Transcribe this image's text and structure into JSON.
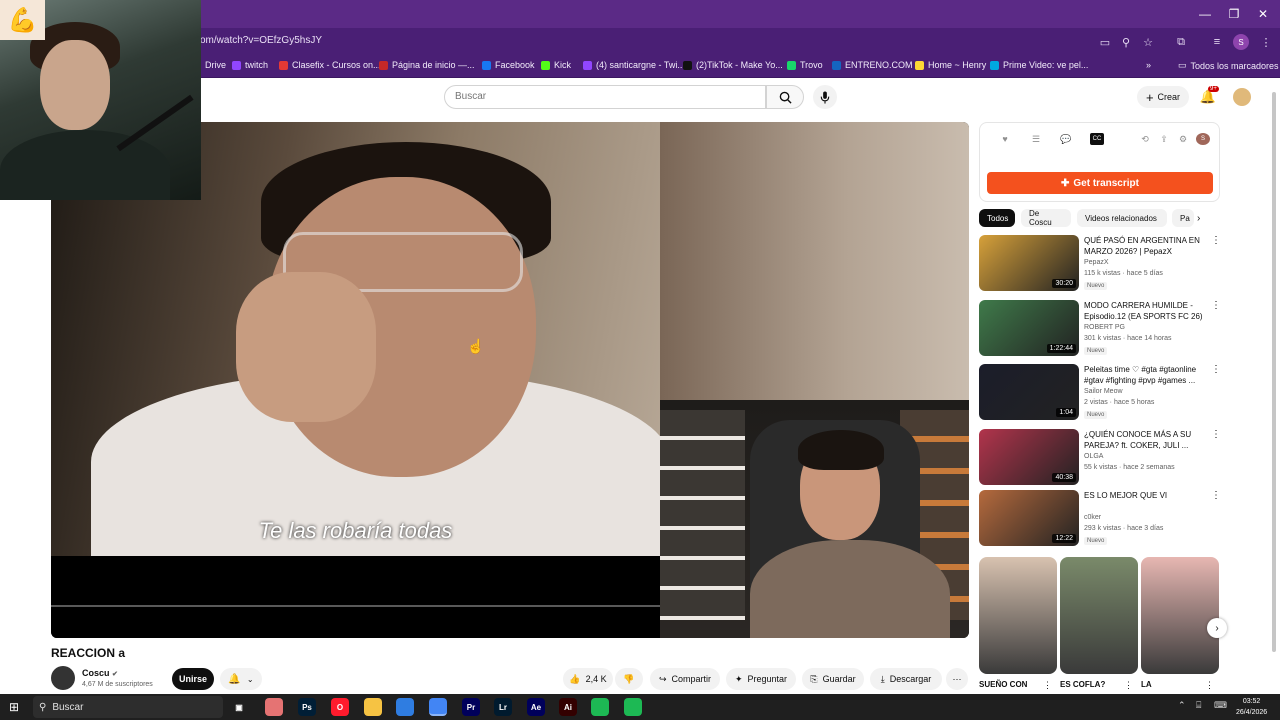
{
  "browser": {
    "url": "om/watch?v=OEfzGy5hsJY",
    "bookmarks": [
      {
        "label": "Drive",
        "color": "#34a853"
      },
      {
        "label": "twitch",
        "color": "#9146ff"
      },
      {
        "label": "Clasefix - Cursos on...",
        "color": "#e53935"
      },
      {
        "label": "Página de inicio —...",
        "color": "#c62828"
      },
      {
        "label": "Facebook",
        "color": "#1877f2"
      },
      {
        "label": "Kick",
        "color": "#53fc18"
      },
      {
        "label": "(4) santicargne - Twi...",
        "color": "#9146ff"
      },
      {
        "label": "(2)TikTok - Make Yo...",
        "color": "#111111"
      },
      {
        "label": "Trovo",
        "color": "#19d66b"
      },
      {
        "label": "ENTRENO.COM",
        "color": "#1565c0"
      },
      {
        "label": "Home ~ Henry",
        "color": "#fdd835"
      },
      {
        "label": "Prime Video: ve pel...",
        "color": "#00a8e1"
      }
    ],
    "all_bookmarks": "Todos los marcadores",
    "profile_initial": "S"
  },
  "header": {
    "search_placeholder": "Buscar",
    "create_label": "Crear",
    "notif_count": "9+"
  },
  "video": {
    "subtitle": "Te las robaría todas",
    "title": "REACCION a",
    "channel": "Coscu",
    "subscribers": "4,67 M de suscriptores",
    "join_label": "Unirse",
    "likes": "2,4 K",
    "share_label": "Compartir",
    "ask_label": "Preguntar",
    "save_label": "Guardar",
    "download_label": "Descargar"
  },
  "sidebar": {
    "panel_initial": "S",
    "transcript_label": "Get transcript",
    "chips": [
      "Todos",
      "De Coscu",
      "Videos relacionados",
      "Pa"
    ],
    "recommendations": [
      {
        "title": "QUÉ PASÓ EN ARGENTINA EN MARZO 2026? | PepazX",
        "channel": "PepazX",
        "meta": "115 k vistas · hace 5 días",
        "badge": "Nuevo",
        "duration": "30:20",
        "color": "#d7a13a"
      },
      {
        "title": "MODO CARRERA HUMILDE - Episodio.12 (EA SPORTS FC 26)",
        "channel": "ROBERT PG",
        "meta": "301 k vistas · hace 14 horas",
        "badge": "Nuevo",
        "duration": "1:22:44",
        "color": "#3f7a4a"
      },
      {
        "title": "Peleitas time ♡ #gta #gtaonline #gtav #fighting #pvp #games ...",
        "channel": "Sailor Meow",
        "meta": "2 vistas · hace 5 horas",
        "badge": "Nuevo",
        "duration": "1:04",
        "color": "#1b1d2a"
      },
      {
        "title": "¿QUIÉN CONOCE MÁS A SU PAREJA? ft. COKER, JULI ...",
        "channel": "OLGA",
        "meta": "55 k vistas · hace 2 semanas",
        "badge": "",
        "duration": "40:38",
        "color": "#b2344c"
      },
      {
        "title": "ES LO MEJOR QUE VI",
        "channel": "c0ker",
        "meta": "293 k vistas · hace 3 días",
        "badge": "Nuevo",
        "duration": "12:22",
        "color": "#b56a3d"
      }
    ],
    "shorts": [
      {
        "title": "SUEÑO CON",
        "color": "#d8c2b0"
      },
      {
        "title": "ES COFLA?",
        "color": "#7a8a6a"
      },
      {
        "title": "LA",
        "color": "#e7b7b2"
      }
    ]
  },
  "taskbar": {
    "search_label": "Buscar",
    "time": "03:52",
    "date": "26/4/2026",
    "apps": [
      {
        "label": "",
        "color": "#e57373",
        "name": "chrome-app"
      },
      {
        "label": "Ps",
        "color": "#001e36",
        "name": "photoshop-app"
      },
      {
        "label": "O",
        "color": "#ff1b2d",
        "name": "opera-app"
      },
      {
        "label": "",
        "color": "#f6c343",
        "name": "file-explorer-app"
      },
      {
        "label": "",
        "color": "#2f7de1",
        "name": "store-app"
      },
      {
        "label": "",
        "color": "#4285f4",
        "name": "chrome-active-app"
      },
      {
        "label": "Pr",
        "color": "#00005b",
        "name": "premiere-app"
      },
      {
        "label": "Lr",
        "color": "#001a2e",
        "name": "lightroom-app"
      },
      {
        "label": "Ae",
        "color": "#00005b",
        "name": "after-effects-app"
      },
      {
        "label": "Ai",
        "color": "#330000",
        "name": "illustrator-app"
      },
      {
        "label": "",
        "color": "#1db954",
        "name": "whatsapp-app"
      },
      {
        "label": "",
        "color": "#1db954",
        "name": "spotify-app"
      }
    ]
  }
}
